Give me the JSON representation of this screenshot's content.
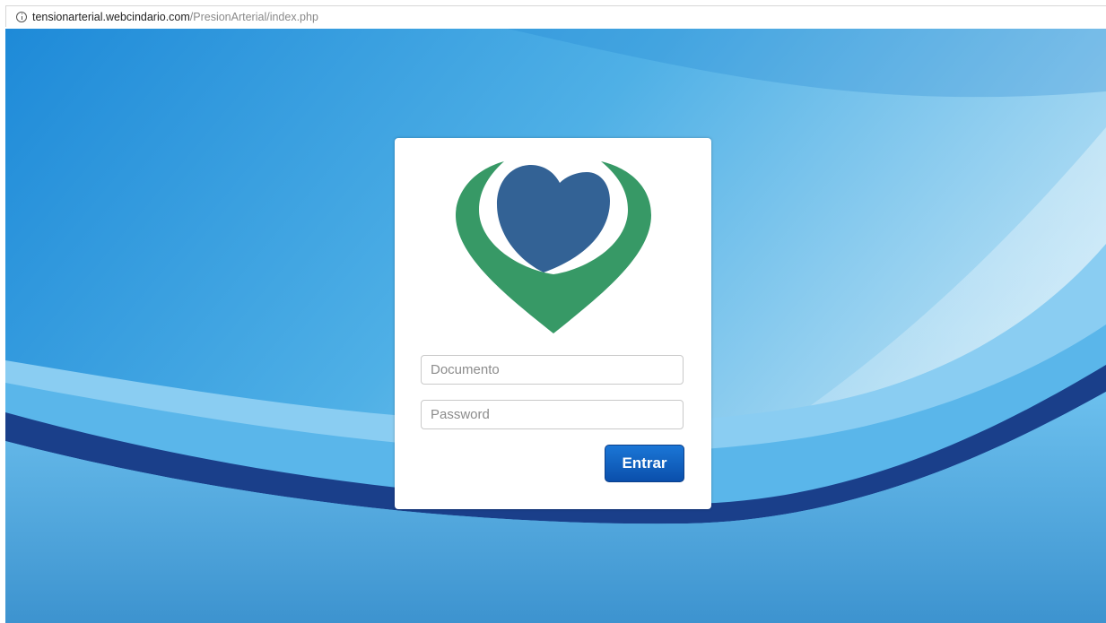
{
  "browser": {
    "url_host": "tensionarterial.webcindario.com",
    "url_path": "/PresionArterial/index.php",
    "info_icon": "info-icon"
  },
  "login": {
    "logo_icon": "heart-logo-icon",
    "document_placeholder": "Documento",
    "password_placeholder": "Password",
    "submit_label": "Entrar"
  },
  "colors": {
    "logo_green": "#379966",
    "logo_blue": "#336295",
    "button_blue": "#0d5fc2",
    "background_blue": "#3f9fdc",
    "wave_dark_blue": "#1a3f8a"
  }
}
